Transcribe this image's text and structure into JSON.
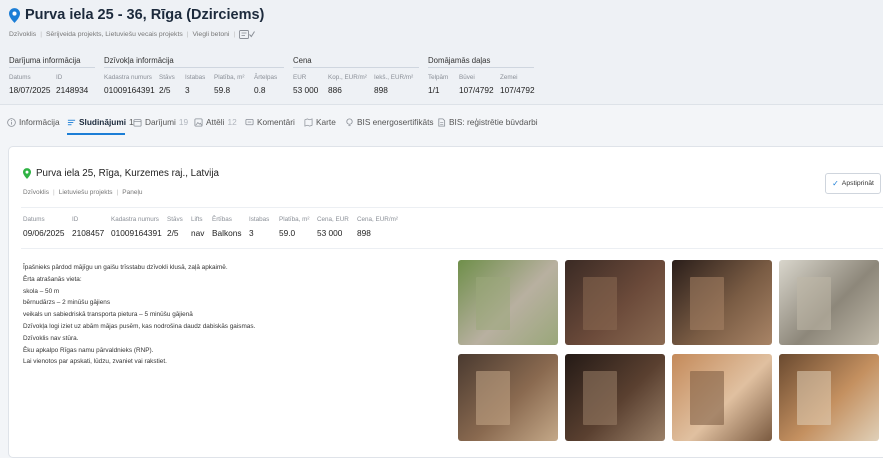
{
  "header": {
    "title": "Purva iela 25 - 36, Rīga (Dzirciems)",
    "tags": [
      "Dzīvoklis",
      "Sērijveida projekts, Lietuviešu vecais projekts",
      "Viegli betoni"
    ],
    "groups": {
      "deal": "Darījuma informācija",
      "apartment": "Dzīvokļa informācija",
      "price": "Cena",
      "shares": "Domājamās daļas"
    },
    "labels": {
      "date": "Datums",
      "id": "ID",
      "cadastre": "Kadastra numurs",
      "floor": "Stāvs",
      "rooms": "Istabas",
      "area": "Platība, m²",
      "outbuilding": "Ārtelpas",
      "eur": "EUR",
      "total_per_m2": "Kop., EUR/m²",
      "inner_per_m2": "Iekš., EUR/m²",
      "premises": "Telpām",
      "building": "Būvei",
      "land": "Zemei"
    },
    "values": {
      "date": "18/07/2025",
      "id": "2148934",
      "cadastre": "01009164391",
      "floor": "2/5",
      "rooms": "3",
      "area": "59.8",
      "outbuilding": "0.8",
      "eur": "53 000",
      "total_per_m2": "886",
      "inner_per_m2": "898",
      "premises": "1/1",
      "building": "107/4792",
      "land": "107/4792"
    }
  },
  "tabs": [
    {
      "label": "Informācija",
      "count": "",
      "icon": "info-icon"
    },
    {
      "label": "Sludinājumi",
      "count": "1",
      "icon": "list-icon"
    },
    {
      "label": "Darījumi",
      "count": "19",
      "icon": "calendar-icon"
    },
    {
      "label": "Attēli",
      "count": "12",
      "icon": "image-icon"
    },
    {
      "label": "Komentāri",
      "count": "",
      "icon": "comment-icon"
    },
    {
      "label": "Karte",
      "count": "",
      "icon": "map-icon"
    },
    {
      "label": "BIS energosertifikāts",
      "count": "",
      "icon": "bulb-icon"
    },
    {
      "label": "BIS: reģistrētie būvdarbi",
      "count": "",
      "icon": "document-icon"
    }
  ],
  "listing": {
    "title": "Purva iela 25, Rīga, Kurzemes raj., Latvija",
    "tags": [
      "Dzīvoklis",
      "Lietuviešu projekts",
      "Paneļu"
    ],
    "confirm_label": "Apstiprināt",
    "labels": {
      "date": "Datums",
      "id": "ID",
      "cadastre": "Kadastra numurs",
      "floor": "Stāvs",
      "lift": "Lifts",
      "amenities": "Ērtības",
      "rooms": "Istabas",
      "area": "Platība, m²",
      "price": "Cena, EUR",
      "price_per_m2": "Cena, EUR/m²"
    },
    "values": {
      "date": "09/06/2025",
      "id": "2108457",
      "cadastre": "01009164391",
      "floor": "2/5",
      "lift": "nav",
      "amenities": "Balkons",
      "rooms": "3",
      "area": "59.0",
      "price": "53 000",
      "price_per_m2": "898"
    },
    "description": [
      "Īpašnieks pārdod mājīgu un gaišu trīsstabu dzīvokli klusā, zaļā apkaimē.",
      "Ērta atrašanās vieta:",
      "skola – 50 m",
      "bērnudārzs – 2 minūšu gājiens",
      "veikals un sabiedriskā transporta pietura – 5 minūšu gājienā",
      "Dzīvokļa logi iziet uz abām mājas pusēm, kas nodrošina daudz dabiskās gaismas.",
      "Dzīvoklis nav stūra.",
      "Ēku apkalpo Rīgas namu pārvaldnieks (RNP).",
      "Lai vienotos par apskati, lūdzu, zvaniet vai rakstiet."
    ],
    "photos": [
      {
        "name": "photo-building-exterior",
        "colors": [
          "#6f8f4a",
          "#b8b0a0",
          "#9aa77a"
        ]
      },
      {
        "name": "photo-hallway-door",
        "colors": [
          "#3a2a24",
          "#6b4a3a",
          "#8a6a52"
        ]
      },
      {
        "name": "photo-wardrobe-room",
        "colors": [
          "#2a1e1a",
          "#7a5c44",
          "#a88466"
        ]
      },
      {
        "name": "photo-kitchen",
        "colors": [
          "#d9d6cc",
          "#8d877a",
          "#bfb8a8"
        ]
      },
      {
        "name": "photo-living-room",
        "colors": [
          "#4a3a30",
          "#8a6a50",
          "#c4a888"
        ]
      },
      {
        "name": "photo-dark-room",
        "colors": [
          "#241a16",
          "#5a4030",
          "#9a8068"
        ]
      },
      {
        "name": "photo-bathroom",
        "colors": [
          "#c48a5a",
          "#e0c0a0",
          "#7a5a40"
        ]
      },
      {
        "name": "photo-toilet",
        "colors": [
          "#6a4a30",
          "#c49060",
          "#e0d0b8"
        ]
      }
    ]
  }
}
